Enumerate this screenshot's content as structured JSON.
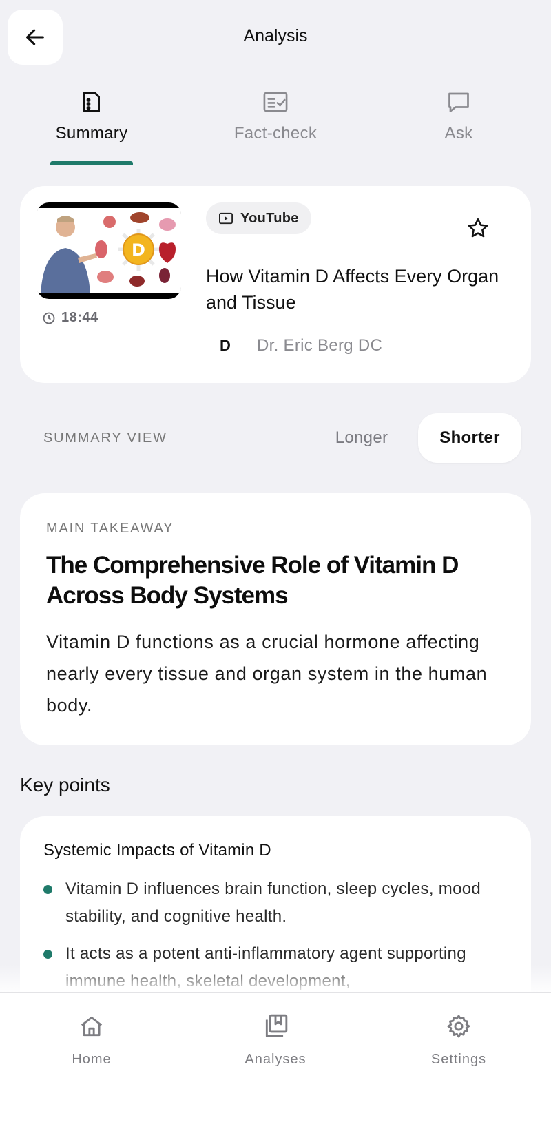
{
  "header": {
    "title": "Analysis",
    "back_icon": "arrow-left-icon"
  },
  "tabs": [
    {
      "label": "Summary",
      "icon": "document-icon",
      "active": true
    },
    {
      "label": "Fact-check",
      "icon": "checklist-icon",
      "active": false
    },
    {
      "label": "Ask",
      "icon": "chat-bubble-icon",
      "active": false
    }
  ],
  "video": {
    "source": "YouTube",
    "title": "How Vitamin D Affects Every Organ and Tissue",
    "duration": "18:44",
    "channel_initial": "D",
    "channel_name": "Dr. Eric Berg DC",
    "thumbnail_letter": "D"
  },
  "summary_view": {
    "label": "SUMMARY VIEW",
    "options": [
      "Longer",
      "Shorter"
    ],
    "selected": "Shorter"
  },
  "takeaway": {
    "kicker": "MAIN TAKEAWAY",
    "title": "The Comprehensive Role of Vitamin D Across Body Systems",
    "body": "Vitamin D functions as a crucial hormone affecting nearly every tissue and organ system in the human body."
  },
  "key_points": {
    "heading": "Key points",
    "section_title": "Systemic Impacts of Vitamin D",
    "items": [
      "Vitamin D influences brain function, sleep cycles, mood stability, and cognitive health.",
      "It acts as a potent anti-inflammatory agent supporting immune health, skeletal development,"
    ]
  },
  "bottom_nav": [
    {
      "label": "Home",
      "icon": "home-icon"
    },
    {
      "label": "Analyses",
      "icon": "bookmark-stack-icon"
    },
    {
      "label": "Settings",
      "icon": "gear-icon"
    }
  ],
  "colors": {
    "accent": "#1f7a6a",
    "background": "#f1f1f5",
    "card": "#ffffff"
  }
}
